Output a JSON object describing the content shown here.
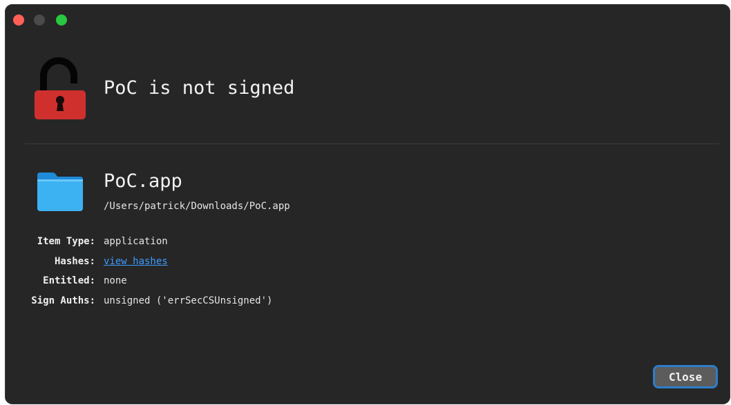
{
  "window": {
    "controls": [
      "close",
      "minimize",
      "zoom"
    ]
  },
  "header": {
    "title": "PoC is not signed",
    "icon": "unlocked-padlock-icon",
    "lock_color": "#d0302d"
  },
  "item": {
    "name": "PoC.app",
    "path": "/Users/patrick/Downloads/PoC.app",
    "icon": "folder-icon"
  },
  "details": [
    {
      "label": "Item Type:",
      "value": "application"
    },
    {
      "label": "Hashes:",
      "value": "view hashes"
    },
    {
      "label": "Entitled:",
      "value": "none"
    },
    {
      "label": "Sign Auths:",
      "value": "unsigned ('errSecCSUnsigned')"
    }
  ],
  "footer": {
    "close_label": "Close"
  },
  "colors": {
    "background": "#262626",
    "link": "#3f9bff",
    "button_focus": "#2e7dc9"
  }
}
